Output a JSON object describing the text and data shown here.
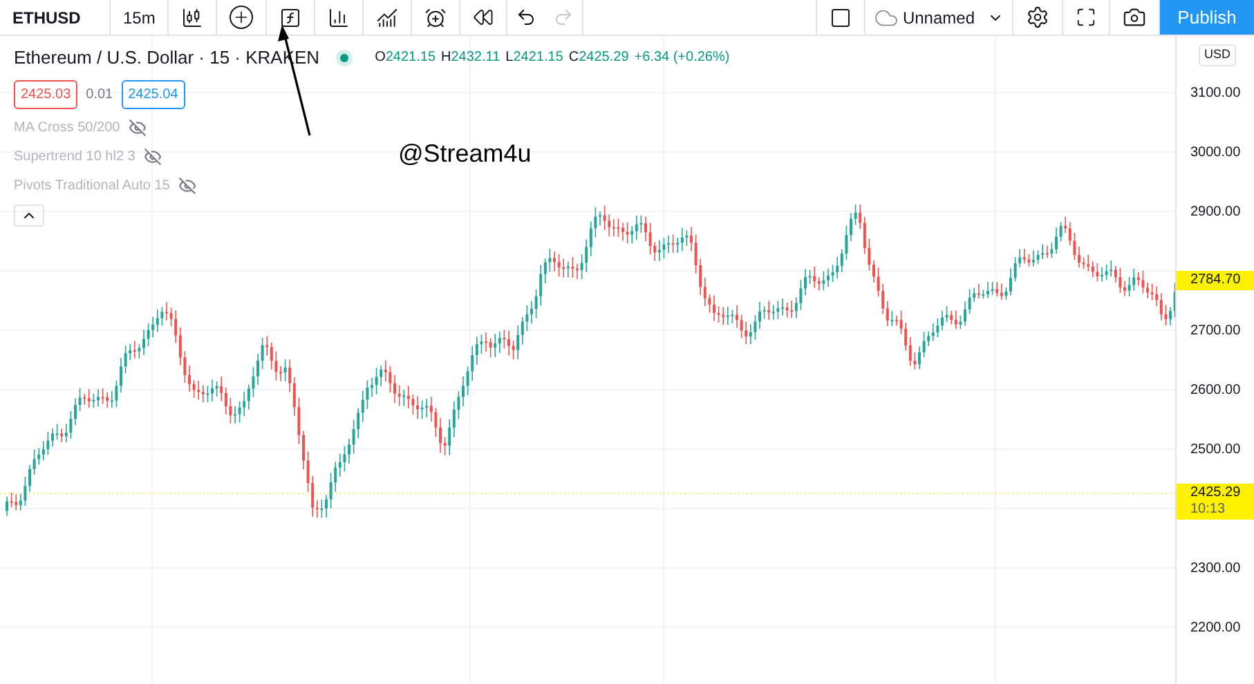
{
  "toolbar": {
    "symbol": "ETHUSD",
    "interval": "15m",
    "layout_name": "Unnamed",
    "publish": "Publish"
  },
  "legend": {
    "title": "Ethereum / U.S. Dollar · 15 · KRAKEN",
    "market_open": true,
    "ohlc": [
      {
        "label": "O",
        "value": "2421.15"
      },
      {
        "label": "H",
        "value": "2432.11"
      },
      {
        "label": "L",
        "value": "2421.15"
      },
      {
        "label": "C",
        "value": "2425.29"
      }
    ],
    "change": "+6.34 (+0.26%)",
    "sell": "2425.03",
    "spread": "0.01",
    "buy": "2425.04",
    "indicators": [
      {
        "name": "MA Cross 50/200",
        "hidden": true
      },
      {
        "name": "Supertrend 10 hl2 3",
        "hidden": true
      },
      {
        "name": "Pivots Traditional Auto 15",
        "hidden": true
      }
    ]
  },
  "price_axis": {
    "currency": "USD",
    "ticks": [
      "3100.00",
      "3000.00",
      "2900.00",
      "2700.00",
      "2600.00",
      "2500.00",
      "2300.00",
      "2200.00"
    ],
    "badges": [
      {
        "price": "2784.70"
      },
      {
        "price": "2425.29",
        "countdown": "10:13"
      }
    ]
  },
  "annotation": {
    "text": "@Stream4u"
  }
}
